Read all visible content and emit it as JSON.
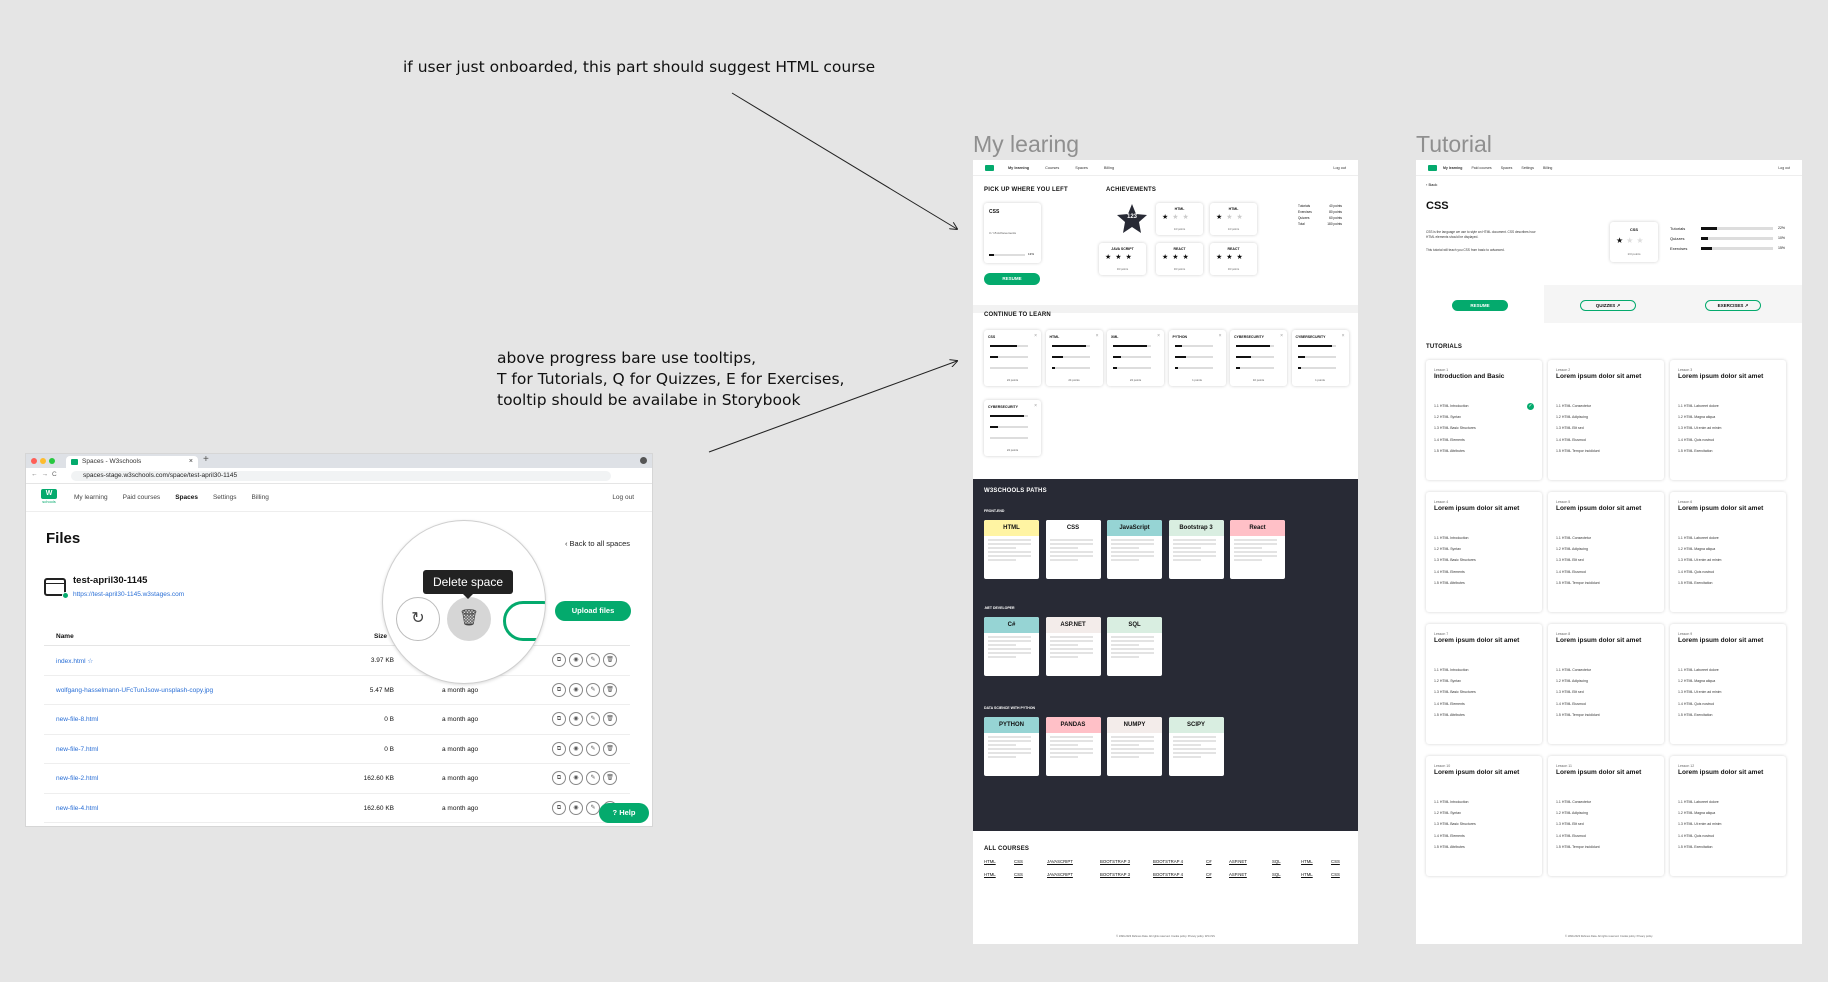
{
  "notes": {
    "top": "if user just onboarded, this part should suggest HTML course",
    "middle_1": "above progress bare use tooltips,",
    "middle_2": "T for Tutorials, Q for Quizzes, E for Exercises,",
    "middle_3": "tooltip should be availabe in Storybook"
  },
  "browser": {
    "tab_title": "Spaces - W3schools",
    "url": "spaces-stage.w3schools.com/space/test-april30-1145",
    "nav": [
      "My learning",
      "Paid courses",
      "Spaces",
      "Settings",
      "Billing"
    ],
    "logout": "Log out",
    "logo_w": "W",
    "logo_sub": "schools",
    "page_title": "Files",
    "back_link": "Back to all spaces",
    "space_name": "test-april30-1145",
    "space_url": "https://test-april30-1145.w3stages.com",
    "upload_label": "Upload files",
    "table_headers": {
      "name": "Name",
      "size": "Size"
    },
    "rows": [
      {
        "name": "index.html ☆",
        "size": "3.97 KB",
        "date": ""
      },
      {
        "name": "wolfgang-hasselmann-UFcTunJsow-unsplash-copy.jpg",
        "size": "5.47 MB",
        "date": "a month ago"
      },
      {
        "name": "new-file-8.html",
        "size": "0 B",
        "date": "a month ago"
      },
      {
        "name": "new-file-7.html",
        "size": "0 B",
        "date": "a month ago"
      },
      {
        "name": "new-file-2.html",
        "size": "162.60 KB",
        "date": "a month ago"
      },
      {
        "name": "new-file-4.html",
        "size": "162.60 KB",
        "date": "a month ago"
      }
    ],
    "help_label": "Help",
    "tooltip": "Delete space"
  },
  "frames": {
    "my_learning_title": "My learing",
    "tutorial_title": "Tutorial"
  },
  "my_learning": {
    "nav": [
      "My learning",
      "Courses",
      "Spaces",
      "Billing"
    ],
    "logout": "Log out",
    "pickup_heading": "PICK UP WHERE YOU LEFT",
    "pickup_course": "CSS",
    "pickup_sub": "3 / 15 Achievements",
    "pickup_pct": "13%",
    "resume": "RESUME",
    "achievements_heading": "ACHIEVEMENTS",
    "badge_count": "123",
    "achievements": [
      {
        "name": "HTML",
        "sub": "1/3 points"
      },
      {
        "name": "HTML",
        "sub": "1/3 points"
      },
      {
        "name": "JAVA SCRIPT",
        "sub": "3/3 points"
      },
      {
        "name": "REACT",
        "sub": "3/3 points"
      },
      {
        "name": "REACT",
        "sub": "3/3 points"
      }
    ],
    "stats": [
      {
        "label": "Tutorials",
        "value": "40 points"
      },
      {
        "label": "Exercises",
        "value": "80 points"
      },
      {
        "label": "Quizzes",
        "value": "60 points"
      },
      {
        "label": "Total",
        "value": "180 points"
      }
    ],
    "continue_heading": "CONTINUE TO LEARN",
    "continue_cards": [
      {
        "name": "CSS",
        "pts": "24 points",
        "fills": [
          0.7,
          0.2,
          0.0
        ]
      },
      {
        "name": "HTML",
        "pts": "24 points",
        "fills": [
          0.9,
          0.3,
          0.1
        ]
      },
      {
        "name": "XML",
        "pts": "24 points",
        "fills": [
          0.9,
          0.2,
          0.1
        ]
      },
      {
        "name": "PYTHON",
        "pts": "1 points",
        "fills": [
          0.2,
          0.3,
          0.1
        ]
      },
      {
        "name": "CYBERSECURITY",
        "pts": "10 points",
        "fills": [
          0.9,
          0.4,
          0.1
        ]
      },
      {
        "name": "CYBERSECURITY",
        "pts": "1 points",
        "fills": [
          0.9,
          0.2,
          0.1
        ]
      },
      {
        "name": "CYBERSECURITY",
        "pts": "24 points",
        "fills": [
          0.9,
          0.2,
          0.0
        ]
      }
    ],
    "paths_heading": "W3SCHOOLS PATHS",
    "paths": [
      {
        "group": "FRONT-END",
        "items": [
          {
            "name": "HTML",
            "color": "#fff4a3"
          },
          {
            "name": "CSS",
            "color": "#ffffff"
          },
          {
            "name": "JavaScript",
            "color": "#96d4d4"
          },
          {
            "name": "Bootstrap 3",
            "color": "#d9eee1"
          },
          {
            "name": "React",
            "color": "#ffc0c7"
          }
        ]
      },
      {
        "group": ".NET DEVELOPER",
        "items": [
          {
            "name": "C#",
            "color": "#96d4d4"
          },
          {
            "name": "ASP.NET",
            "color": "#f3ecea"
          },
          {
            "name": "SQL",
            "color": "#d9eee1"
          }
        ]
      },
      {
        "group": "DATA SCIENCE WITH PYTHON",
        "items": [
          {
            "name": "PYTHON",
            "color": "#96d4d4"
          },
          {
            "name": "PANDAS",
            "color": "#ffc0c7"
          },
          {
            "name": "NUMPY",
            "color": "#f3ecea"
          },
          {
            "name": "SCIPY",
            "color": "#d9eee1"
          }
        ]
      }
    ],
    "all_courses_heading": "ALL COURSES",
    "all_courses": [
      "HTML",
      "CSS",
      "JAVASCRIPT",
      "BOOTSTRAP 3",
      "BOOTSTRAP 4",
      "C#",
      "ASP.NET",
      "SQL",
      "HTML",
      "CSS"
    ],
    "footer": "© 1999-2023 Refsnes Data. All rights reserved. Cookie policy. Privacy policy. W3.CSS"
  },
  "tutorial": {
    "nav": [
      "My learning",
      "Paid courses",
      "Spaces",
      "Settings",
      "Billing"
    ],
    "logout": "Log out",
    "back": "Back",
    "title": "CSS",
    "desc_1": "CSS is the language we use to style an HTML document. CSS describes how HTML elements should be displayed.",
    "desc_2": "This tutorial will teach you CSS from basic to advanced.",
    "badge_name": "CSS",
    "badge_sub": "1/3 points",
    "progress": [
      {
        "label": "Tutorials",
        "pct": "22%",
        "fill": 0.22
      },
      {
        "label": "Quizzes",
        "pct": "10%",
        "fill": 0.1
      },
      {
        "label": "Exercises",
        "pct": "15%",
        "fill": 0.15
      }
    ],
    "resume": "RESUME",
    "quizzes": "QUIZZES",
    "exercises": "EXERCISES",
    "tutorials_heading": "TUTORIALS",
    "lessons": [
      {
        "label": "Lesson 1",
        "title": "Introduction and Basic",
        "items": [
          "1.1 HTML Introduction",
          "1.2 HTML Syntax",
          "1.3 HTML Basic Structures",
          "1.4 HTML Elements",
          "1.5 HTML Attributes"
        ]
      },
      {
        "label": "Lesson 2",
        "title": "Lorem ipsum dolor sit amet",
        "items": [
          "1.1 HTML Consectetur",
          "1.2 HTML Adipiscing",
          "1.3 HTML Elit sed",
          "1.4 HTML Eiusmod",
          "1.5 HTML Tempor incididunt"
        ]
      },
      {
        "label": "Lesson 3",
        "title": "Lorem ipsum dolor sit amet",
        "items": [
          "1.1 HTML Laboreet dolore",
          "1.2 HTML Magna aliqua",
          "1.3 HTML Ut enim ad minim",
          "1.4 HTML Quis nostrud",
          "1.5 HTML Exercitation"
        ]
      },
      {
        "label": "Lesson 4",
        "title": "Lorem ipsum dolor sit amet",
        "items": [
          "1.1 HTML Introduction",
          "1.2 HTML Syntax",
          "1.3 HTML Basic Structures",
          "1.4 HTML Elements",
          "1.5 HTML Attributes"
        ]
      },
      {
        "label": "Lesson 5",
        "title": "Lorem ipsum dolor sit amet",
        "items": [
          "1.1 HTML Consectetur",
          "1.2 HTML Adipiscing",
          "1.3 HTML Elit sed",
          "1.4 HTML Eiusmod",
          "1.5 HTML Tempor incididunt"
        ]
      },
      {
        "label": "Lesson 6",
        "title": "Lorem ipsum dolor sit amet",
        "items": [
          "1.1 HTML Laboreet dolore",
          "1.2 HTML Magna aliqua",
          "1.3 HTML Ut enim ad minim",
          "1.4 HTML Quis nostrud",
          "1.5 HTML Exercitation"
        ]
      },
      {
        "label": "Lesson 7",
        "title": "Lorem ipsum dolor sit amet",
        "items": [
          "1.1 HTML Introduction",
          "1.2 HTML Syntax",
          "1.3 HTML Basic Structures",
          "1.4 HTML Elements",
          "1.5 HTML Attributes"
        ]
      },
      {
        "label": "Lesson 8",
        "title": "Lorem ipsum dolor sit amet",
        "items": [
          "1.1 HTML Consectetur",
          "1.2 HTML Adipiscing",
          "1.3 HTML Elit sed",
          "1.4 HTML Eiusmod",
          "1.5 HTML Tempor incididunt"
        ]
      },
      {
        "label": "Lesson 9",
        "title": "Lorem ipsum dolor sit amet",
        "items": [
          "1.1 HTML Laboreet dolore",
          "1.2 HTML Magna aliqua",
          "1.3 HTML Ut enim ad minim",
          "1.4 HTML Quis nostrud",
          "1.5 HTML Exercitation"
        ]
      },
      {
        "label": "Lesson 10",
        "title": "Lorem ipsum dolor sit amet",
        "items": [
          "1.1 HTML Introduction",
          "1.2 HTML Syntax",
          "1.3 HTML Basic Structures",
          "1.4 HTML Elements",
          "1.5 HTML Attributes"
        ]
      },
      {
        "label": "Lesson 11",
        "title": "Lorem ipsum dolor sit amet",
        "items": [
          "1.1 HTML Consectetur",
          "1.2 HTML Adipiscing",
          "1.3 HTML Elit sed",
          "1.4 HTML Eiusmod",
          "1.5 HTML Tempor incididunt"
        ]
      },
      {
        "label": "Lesson 12",
        "title": "Lorem ipsum dolor sit amet",
        "items": [
          "1.1 HTML Laboreet dolore",
          "1.2 HTML Magna aliqua",
          "1.3 HTML Ut enim ad minim",
          "1.4 HTML Quis nostrud",
          "1.5 HTML Exercitation"
        ]
      }
    ],
    "footer": "© 1999-2023 Refsnes Data. All rights reserved. Cookie policy. Privacy policy."
  }
}
